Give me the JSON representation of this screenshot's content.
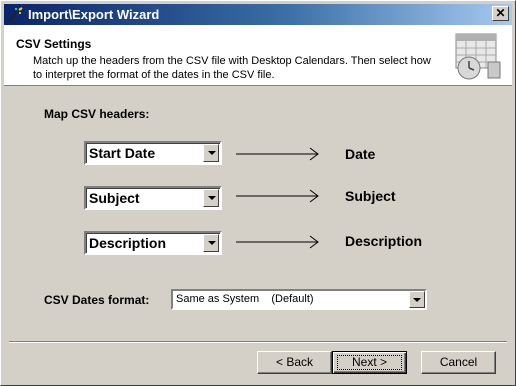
{
  "window": {
    "title": "Import\\Export Wizard",
    "close_label": "✕",
    "app_icon": "wizard-wand-icon"
  },
  "header": {
    "title": "CSV Settings",
    "description": "Match up the headers from the CSV file with Desktop Calendars. Then select how to interpret the format of the dates in the CSV file.",
    "icon": "calendar-clock-icon"
  },
  "mapping": {
    "label": "Map CSV headers:",
    "rows": [
      {
        "selected": "Start Date",
        "target": "Date"
      },
      {
        "selected": "Subject",
        "target": "Subject"
      },
      {
        "selected": "Description",
        "target": "Description"
      }
    ]
  },
  "dates_format": {
    "label": "CSV Dates format:",
    "selected": "Same as System    (Default)"
  },
  "buttons": {
    "back": "< Back",
    "next": "Next >",
    "cancel": "Cancel"
  }
}
